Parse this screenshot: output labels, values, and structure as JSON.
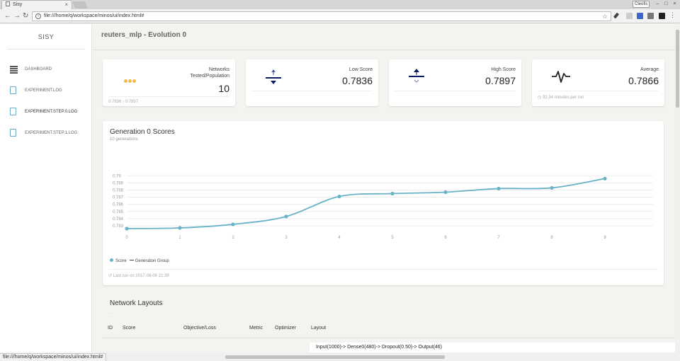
{
  "browser": {
    "tab_title": "Sisy",
    "tab_close": "×",
    "url": "file:///home/q/workspace/minos/ui/index.html#",
    "profile_badge": "Cleofis",
    "status_url": "file:///home/q/workspace/minos/ui/index.html#"
  },
  "sidebar": {
    "brand": "SISY",
    "items": [
      {
        "label": "DASHBOARD",
        "icon": "bank-icon"
      },
      {
        "label": "EXPERIMENT.LOG",
        "icon": "file-icon"
      },
      {
        "label": "EXPERIMENT.STEP.0.LOG",
        "icon": "file-icon"
      },
      {
        "label": "EXPERIMENT.STEP.1.LOG",
        "icon": "file-icon"
      }
    ]
  },
  "header": {
    "title": "reuters_mlp - Evolution 0"
  },
  "stats": {
    "networks": {
      "label_line1": "Networks",
      "label_line2": "Tested/Population",
      "value": "10",
      "footer_from": "0.7836",
      "footer_to": "0.7897"
    },
    "low": {
      "label": "Low Score",
      "value": "0.7836"
    },
    "high": {
      "label": "High Score",
      "value": "0.7897"
    },
    "average": {
      "label": "Average",
      "value": "0.7866",
      "footer": "92.34 minutes per run"
    }
  },
  "chart": {
    "title": "Generation 0 Scores",
    "subtitle": "10 generations",
    "legend_score": "Score",
    "legend_group": "Generation Group",
    "footer": "Last run on 2017-06-06 21:39"
  },
  "chart_data": {
    "type": "line",
    "title": "Generation 0 Scores",
    "x": [
      0,
      1,
      2,
      3,
      4,
      5,
      6,
      7,
      8,
      9
    ],
    "series": [
      {
        "name": "Score",
        "values": [
          0.7826,
          0.7827,
          0.7832,
          0.7843,
          0.7871,
          0.7875,
          0.7877,
          0.7882,
          0.7883,
          0.7896
        ]
      }
    ],
    "yticks": [
      "0.783",
      "0.784",
      "0.785",
      "0.786",
      "0.787",
      "0.788",
      "0.789",
      "0.79"
    ],
    "ylim": [
      0.7826,
      0.7925
    ],
    "grid": true,
    "legend": "bottom-left",
    "colors": {
      "line": "#68b3c8"
    }
  },
  "layouts": {
    "title": "Network Layouts",
    "tick": "-",
    "columns": [
      "ID",
      "Score",
      "Objective/Loss",
      "Metric",
      "Optimizer",
      "Layout"
    ],
    "row_layout": "Input(1000)-> Dense0(480)-> Dropout(0.50)-> Output(46)"
  },
  "colors": {
    "accent": "#68b3c8",
    "warning": "#f3bb45",
    "navy": "#0a1b6b",
    "background": "#f4f3ef"
  }
}
